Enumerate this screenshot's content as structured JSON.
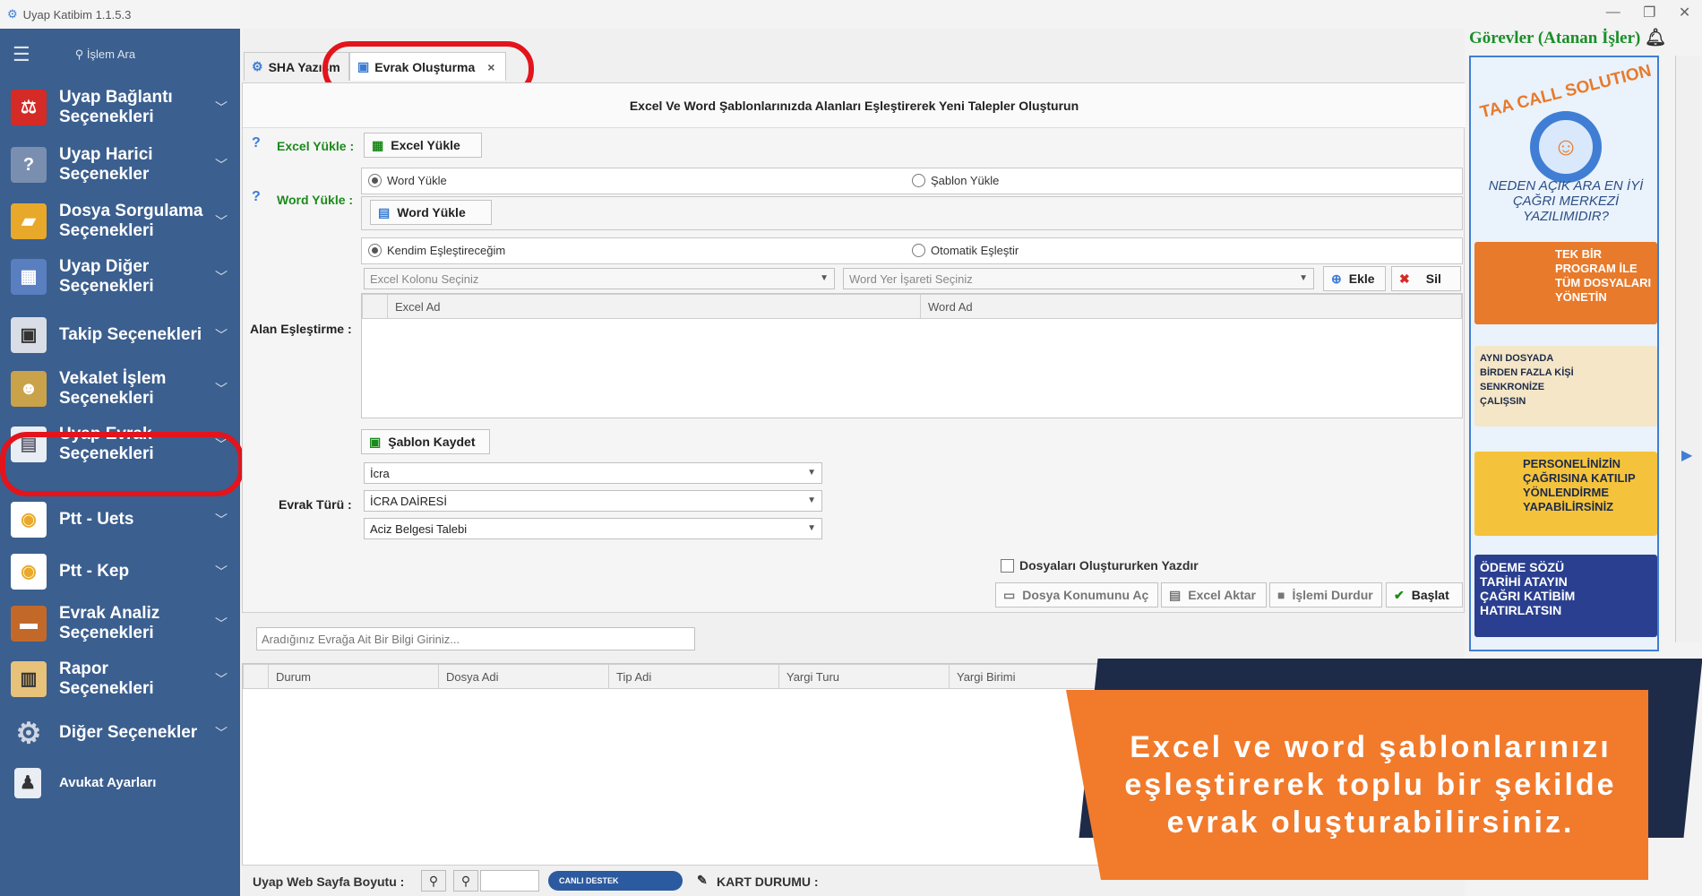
{
  "app": {
    "title": "Uyap Katibim 1.1.5.3"
  },
  "sidebar": {
    "search_placeholder": "İşlem Ara",
    "items": [
      {
        "label": "Uyap Bağlantı Seçenekleri",
        "icon": "uyap-logo-icon"
      },
      {
        "label": "Uyap Harici Seçenekler",
        "icon": "help-book-icon"
      },
      {
        "label": "Dosya Sorgulama Seçenekleri",
        "icon": "folder-icon"
      },
      {
        "label": "Uyap Diğer Seçenekleri",
        "icon": "grid-icon"
      },
      {
        "label": "Takip Seçenekleri",
        "icon": "frame-icon"
      },
      {
        "label": "Vekalet İşlem Seçenekleri",
        "icon": "person-icon"
      },
      {
        "label": "Uyap Evrak Seçenekleri",
        "icon": "document-icon"
      },
      {
        "label": "Ptt - Uets",
        "icon": "ptt-icon"
      },
      {
        "label": "Ptt - Kep",
        "icon": "ptt-icon"
      },
      {
        "label": "Evrak Analiz Seçenekleri",
        "icon": "briefcase-icon"
      },
      {
        "label": "Rapor Seçenekleri",
        "icon": "clipboard-icon"
      },
      {
        "label": "Diğer Seçenekler",
        "icon": "gear-icon"
      },
      {
        "label": "Avukat Ayarları",
        "icon": "lawyer-icon"
      }
    ]
  },
  "tabs": [
    {
      "label": "SHA Yazışm"
    },
    {
      "label": "Evrak Oluşturma",
      "close": "×"
    }
  ],
  "panel": {
    "header": "Excel Ve Word Şablonlarınızda Alanları Eşleştirerek Yeni Talepler Oluşturun",
    "excel_label": "Excel Yükle :",
    "excel_button": "Excel Yükle",
    "word_label": "Word Yükle :",
    "word_radio": "Word Yükle",
    "template_radio": "Şablon Yükle",
    "word_button": "Word Yükle",
    "match_self": "Kendim Eşleştireceğim",
    "match_auto": "Otomatik Eşleştir",
    "excel_col_placeholder": "Excel Kolonu Seçiniz",
    "word_mark_placeholder": "Word Yer İşareti Seçiniz",
    "add": "Ekle",
    "delete": "Sil",
    "field_label": "Alan Eşleştirme :",
    "col_excel": "Excel Ad",
    "col_word": "Word Ad",
    "save_template": "Şablon Kaydet",
    "doc_type_label": "Evrak Türü :",
    "doc_type1": "İcra",
    "doc_type2": "İCRA DAİRESİ",
    "doc_type3": "Aciz Belgesi Talebi",
    "print_check": "Dosyaları Oluştururken Yazdır",
    "open_location": "Dosya Konumunu Aç",
    "export_excel": "Excel Aktar",
    "stop": "İşlemi Durdur",
    "start": "Başlat"
  },
  "results": {
    "search_placeholder": "Aradığınız Evrağa Ait Bir Bilgi Giriniz...",
    "columns": [
      "Durum",
      "Dosya Adi",
      "Tip Adi",
      "Yargi Turu",
      "Yargi Birimi"
    ]
  },
  "status": {
    "page_size": "Uyap Web Sayfa Boyutu :",
    "live": "CANLI DESTEK",
    "card": "KART DURUMU :"
  },
  "right": {
    "title": "Görevler (Atanan İşler)",
    "brand": "TAA CALL SOLUTION",
    "q": "NEDEN AÇIK ARA EN İYİ ÇAĞRI MERKEZİ YAZILIMIDIR?",
    "ad1": "TEK BİR PROGRAM İLE TÜM DOSYALARI YÖNETİN",
    "ad2": "AYNI DOSYADA BİRDEN FAZLA KİŞİ SENKRONİZE ÇALIŞSIN",
    "ad3": "PERSONELİNİZİN ÇAĞRISINA KATILIP YÖNLENDİRME YAPABİLİRSİNİZ",
    "ad4": "ÖDEME SÖZÜ TARİHİ ATAYIN ÇAĞRI KATİBİM HATIRLATSIN"
  },
  "overlay": {
    "text": "Excel ve word şablonlarınızı eşleştirerek toplu bir şekilde evrak oluşturabilirsiniz."
  },
  "colors": {
    "sidebar": "#3b5f8f",
    "highlight": "#e3141b",
    "accent_green": "#1a8f2a",
    "orange": "#f27a2b",
    "navy": "#1e2b48"
  }
}
